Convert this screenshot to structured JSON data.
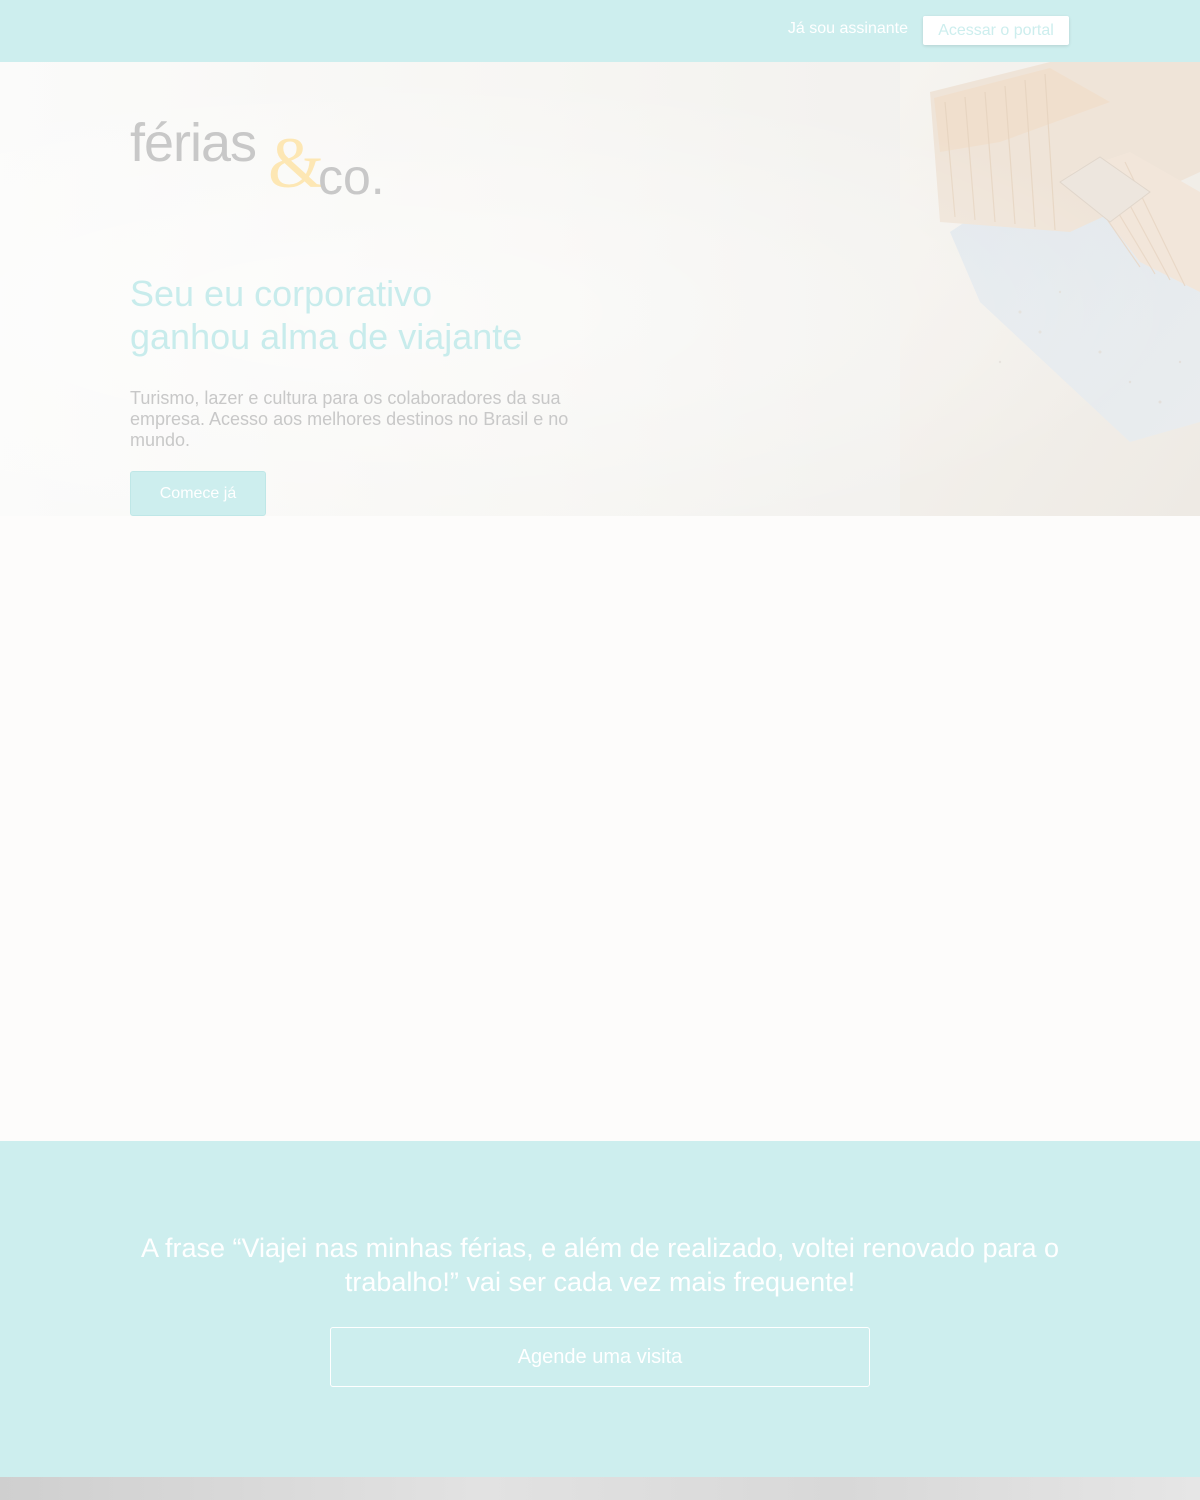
{
  "topbar": {
    "subscriber_text": "Já sou assinante",
    "portal_button": "Acessar o portal"
  },
  "logo": {
    "ferias": "férias",
    "amp": "&",
    "co": "co."
  },
  "hero": {
    "headline_line1": "Seu eu corporativo",
    "headline_line2": "ganhou alma de viajante",
    "subtext": "Turismo, lazer e cultura para os colaboradores da sua empresa. Acesso aos melhores destinos no Brasil e no mundo.",
    "cta_button": "Comece já"
  },
  "quote_band": {
    "quote": "A frase “Viajei nas minhas férias, e além de realizado, voltei renovado para o trabalho!” vai ser cada vez mais frequente!",
    "visit_button": "Agende uma visita"
  },
  "colors": {
    "accent": "#cdeeee",
    "logo_gray": "#c8c8c8",
    "logo_amp": "#fde7b4",
    "background": "#fdfcfb"
  }
}
